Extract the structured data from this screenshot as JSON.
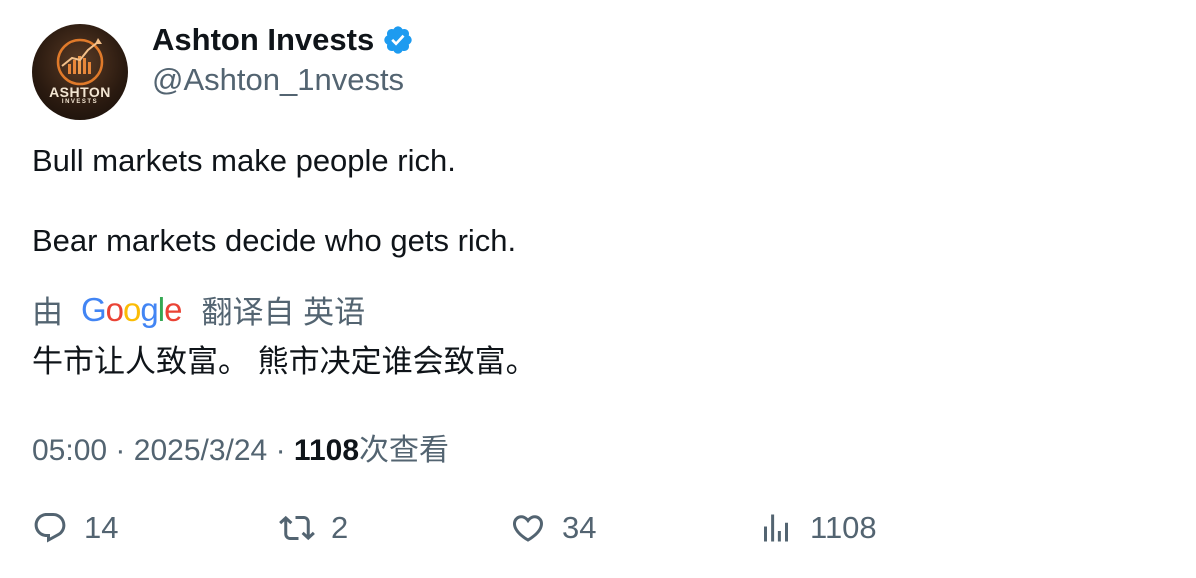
{
  "author": {
    "display_name": "Ashton Invests",
    "handle": "@Ashton_1nvests",
    "avatar_text_1": "ASHTON",
    "avatar_text_2": "INVESTS",
    "verified": true
  },
  "tweet": {
    "line1": "Bull markets make people rich.",
    "line2": "Bear markets decide who gets rich."
  },
  "translation": {
    "prefix": "由",
    "provider": "Google",
    "suffix": "翻译自 英语",
    "text": "牛市让人致富。 熊市决定谁会致富。"
  },
  "meta": {
    "time": "05:00",
    "separator": "·",
    "date": "2025/3/24",
    "views_count": "1108",
    "views_label": "次查看"
  },
  "actions": {
    "replies": "14",
    "retweets": "2",
    "likes": "34",
    "views": "1108"
  },
  "colors": {
    "verified": "#1d9bf0",
    "secondary_text": "#536471",
    "primary_text": "#0f1419"
  }
}
